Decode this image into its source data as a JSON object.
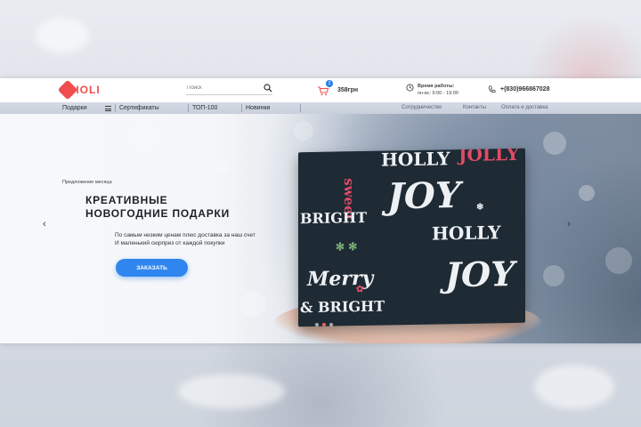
{
  "header": {
    "logo": "HOLI",
    "search_placeholder": "Поиск",
    "cart": {
      "count": "2",
      "total": "358грн"
    },
    "hours": {
      "title": "Время работы:",
      "value": "пн-вс: 9:00 - 19:00"
    },
    "phone": "+(830)966867028"
  },
  "nav": {
    "left": [
      "Подарки",
      "Сертификаты",
      "ТОП-100",
      "Новинки"
    ],
    "right": [
      "Сотрудничество",
      "Контакты",
      "Оплата и доставка"
    ]
  },
  "hero": {
    "eyebrow": "Предложение месяца",
    "title_line1": "КРЕАТИВНЫЕ",
    "title_line2": "НОВОГОДНИЕ ПОДАРКИ",
    "subtitle_line1": "По самым низким ценам плюс доставка за наш счет",
    "subtitle_line2": "И маленький сюрприз от каждой покупки",
    "button": "ЗАКАЗАТЬ",
    "prev_arrow": "‹",
    "next_arrow": "›",
    "slides": 3,
    "active_slide": 2
  },
  "gift_box_text": {
    "holly": "HOLLY",
    "jolly": "JOLLY",
    "joy": "JOY",
    "sweet": "sweet",
    "bright": "BRIGHT",
    "merry": "Merry",
    "and_bright": "& BRIGHT"
  },
  "colors": {
    "accent": "#2f86ee",
    "logo": "#f04e4e",
    "active_dot": "#f0645a"
  }
}
